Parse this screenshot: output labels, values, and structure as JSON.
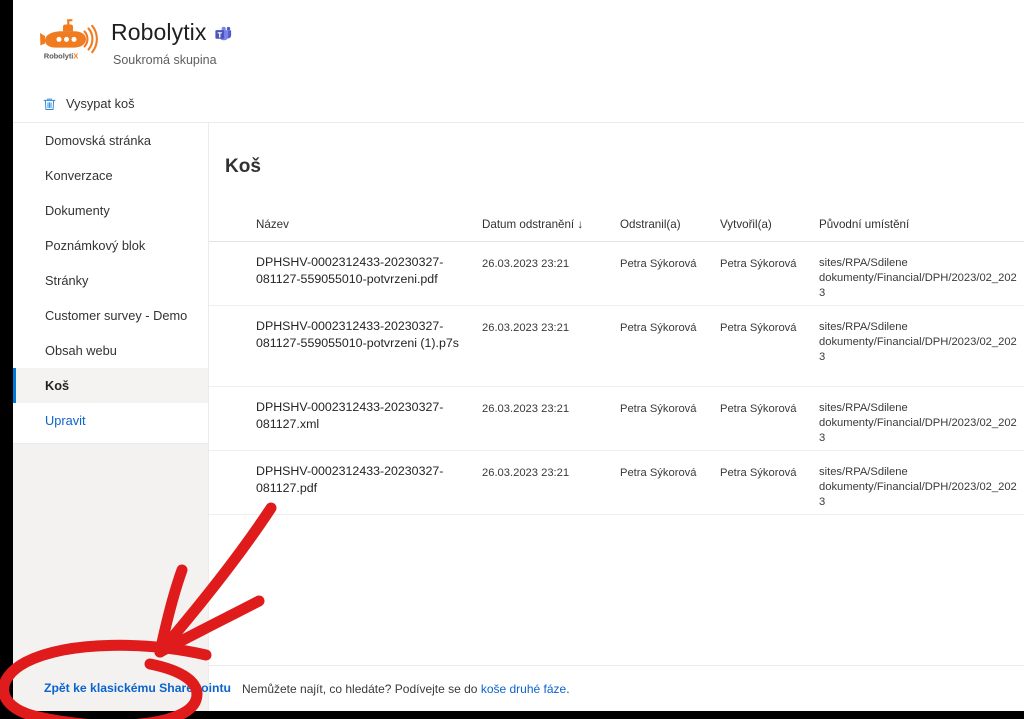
{
  "header": {
    "site_title": "Robolytix",
    "site_subtitle": "Soukromá skupina",
    "logo_text": "RobolytiX",
    "teams_icon": "teams-icon"
  },
  "command_bar": {
    "empty_bin_label": "Vysypat koš",
    "empty_bin_icon": "trash-icon"
  },
  "sidebar": {
    "items": [
      {
        "label": "Domovská stránka",
        "selected": false,
        "link": false
      },
      {
        "label": "Konverzace",
        "selected": false,
        "link": false
      },
      {
        "label": "Dokumenty",
        "selected": false,
        "link": false
      },
      {
        "label": "Poznámkový blok",
        "selected": false,
        "link": false
      },
      {
        "label": "Stránky",
        "selected": false,
        "link": false
      },
      {
        "label": "Customer survey - Demo",
        "selected": false,
        "link": false
      },
      {
        "label": "Obsah webu",
        "selected": false,
        "link": false
      },
      {
        "label": "Koš",
        "selected": true,
        "link": false
      },
      {
        "label": "Upravit",
        "selected": false,
        "link": true
      }
    ],
    "classic_link": "Zpět ke klasickému SharePointu"
  },
  "main": {
    "page_title": "Koš",
    "columns": {
      "icon": "file-type-icon",
      "name": "Název",
      "deleted_date": "Datum odstranění",
      "sort_indicator": "↓",
      "deleted_by": "Odstranil(a)",
      "created_by": "Vytvořil(a)",
      "original_location": "Původní umístění"
    },
    "rows": [
      {
        "icon": "pdf-file-icon",
        "name": "DPHSHV-0002312433-20230327-081127-559055010-potvrzeni.pdf",
        "deleted_date": "26.03.2023 23:21",
        "deleted_by": "Petra Sýkorová",
        "created_by": "Petra Sýkorová",
        "original_location": "sites/RPA/Sdilene dokumenty/Financial/DPH/2023/02_2023"
      },
      {
        "icon": "generic-file-icon",
        "name": "DPHSHV-0002312433-20230327-081127-559055010-potvrzeni (1).p7s",
        "deleted_date": "26.03.2023 23:21",
        "deleted_by": "Petra Sýkorová",
        "created_by": "Petra Sýkorová",
        "original_location": "sites/RPA/Sdilene dokumenty/Financial/DPH/2023/02_2023"
      },
      {
        "icon": "xml-file-icon",
        "name": "DPHSHV-0002312433-20230327-081127.xml",
        "deleted_date": "26.03.2023 23:21",
        "deleted_by": "Petra Sýkorová",
        "created_by": "Petra Sýkorová",
        "original_location": "sites/RPA/Sdilene dokumenty/Financial/DPH/2023/02_2023"
      },
      {
        "icon": "pdf-file-icon",
        "name": "DPHSHV-0002312433-20230327-081127.pdf",
        "deleted_date": "26.03.2023 23:21",
        "deleted_by": "Petra Sýkorová",
        "created_by": "Petra Sýkorová",
        "original_location": "sites/RPA/Sdilene dokumenty/Financial/DPH/2023/02_2023"
      }
    ],
    "footer_note_prefix": "Nemůžete najít, co hledáte? Podívejte se do ",
    "footer_note_link": "koše druhé fáze",
    "footer_note_suffix": "."
  },
  "annotation": {
    "color": "#e01b1b",
    "shapes": [
      "arrow-pointing-to-classic-link",
      "ellipse-around-classic-link"
    ]
  },
  "colors": {
    "accent": "#0078d4",
    "link": "#0b63ce",
    "selected_nav_bg": "#f4f3f2",
    "sidebar_fill": "#f3f2f1",
    "annotation_red": "#e01b1b",
    "logo_orange": "#f07c22",
    "pdf_red": "#d0372a"
  }
}
